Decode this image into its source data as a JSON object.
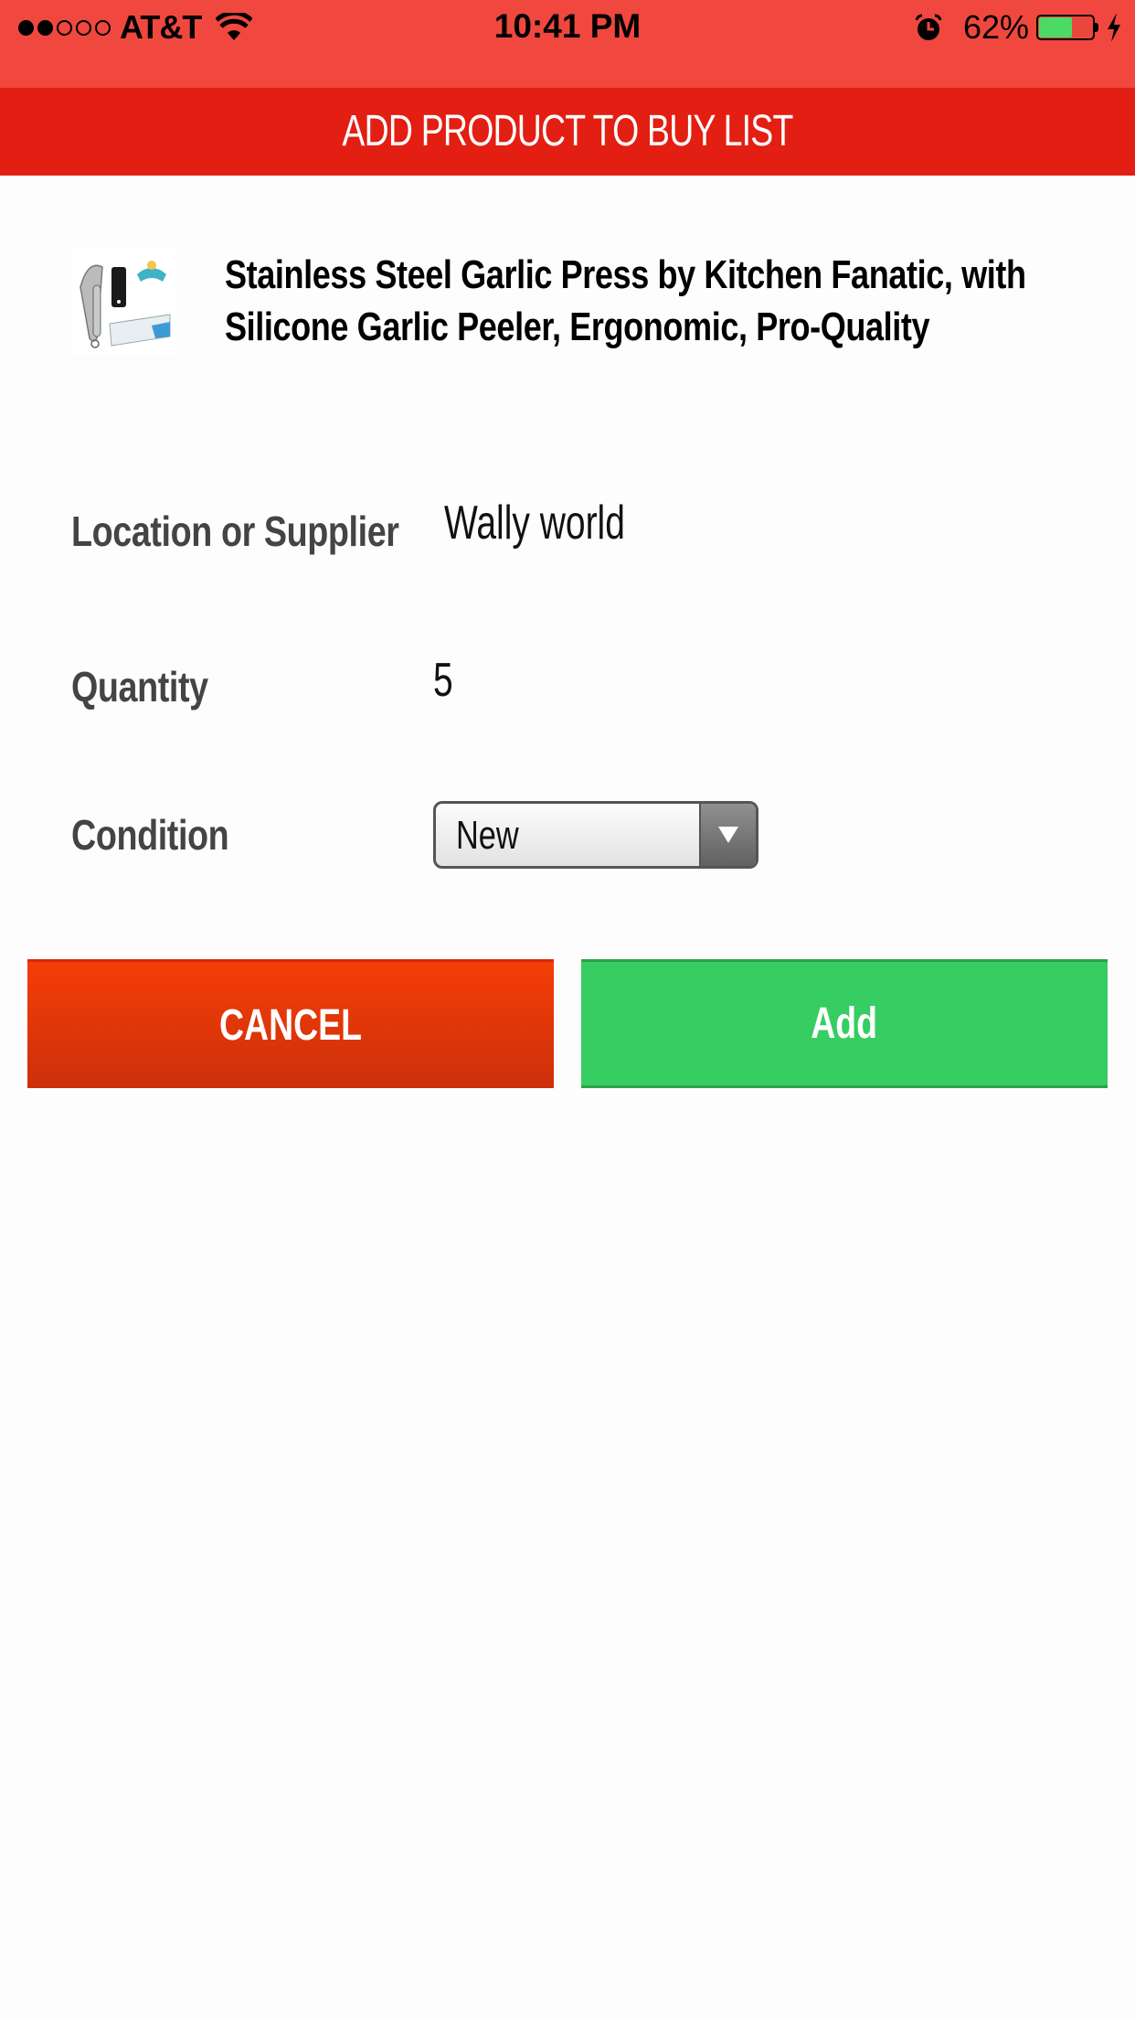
{
  "status_bar": {
    "signal_filled": 2,
    "signal_total": 5,
    "carrier": "AT&T",
    "time": "10:41 PM",
    "battery_percent_label": "62%",
    "battery_level": 0.62,
    "icons": [
      "wifi-icon",
      "alarm-icon",
      "battery-icon",
      "charging-bolt-icon"
    ]
  },
  "header": {
    "title": "ADD PRODUCT TO BUY LIST",
    "color": "#e31e12"
  },
  "product": {
    "title": "Stainless Steel Garlic Press by Kitchen Fanatic, with Silicone Garlic Peeler, Ergonomic, Pro-Quality",
    "image_alt": "garlic press product image"
  },
  "form": {
    "location": {
      "label": "Location or Supplier",
      "value": "Wally world"
    },
    "quantity": {
      "label": "Quantity",
      "value": "5"
    },
    "condition": {
      "label": "Condition",
      "selected": "New"
    }
  },
  "buttons": {
    "cancel": "CANCEL",
    "add": "Add",
    "cancel_color": "#f03e08",
    "add_color": "#36cd62"
  }
}
